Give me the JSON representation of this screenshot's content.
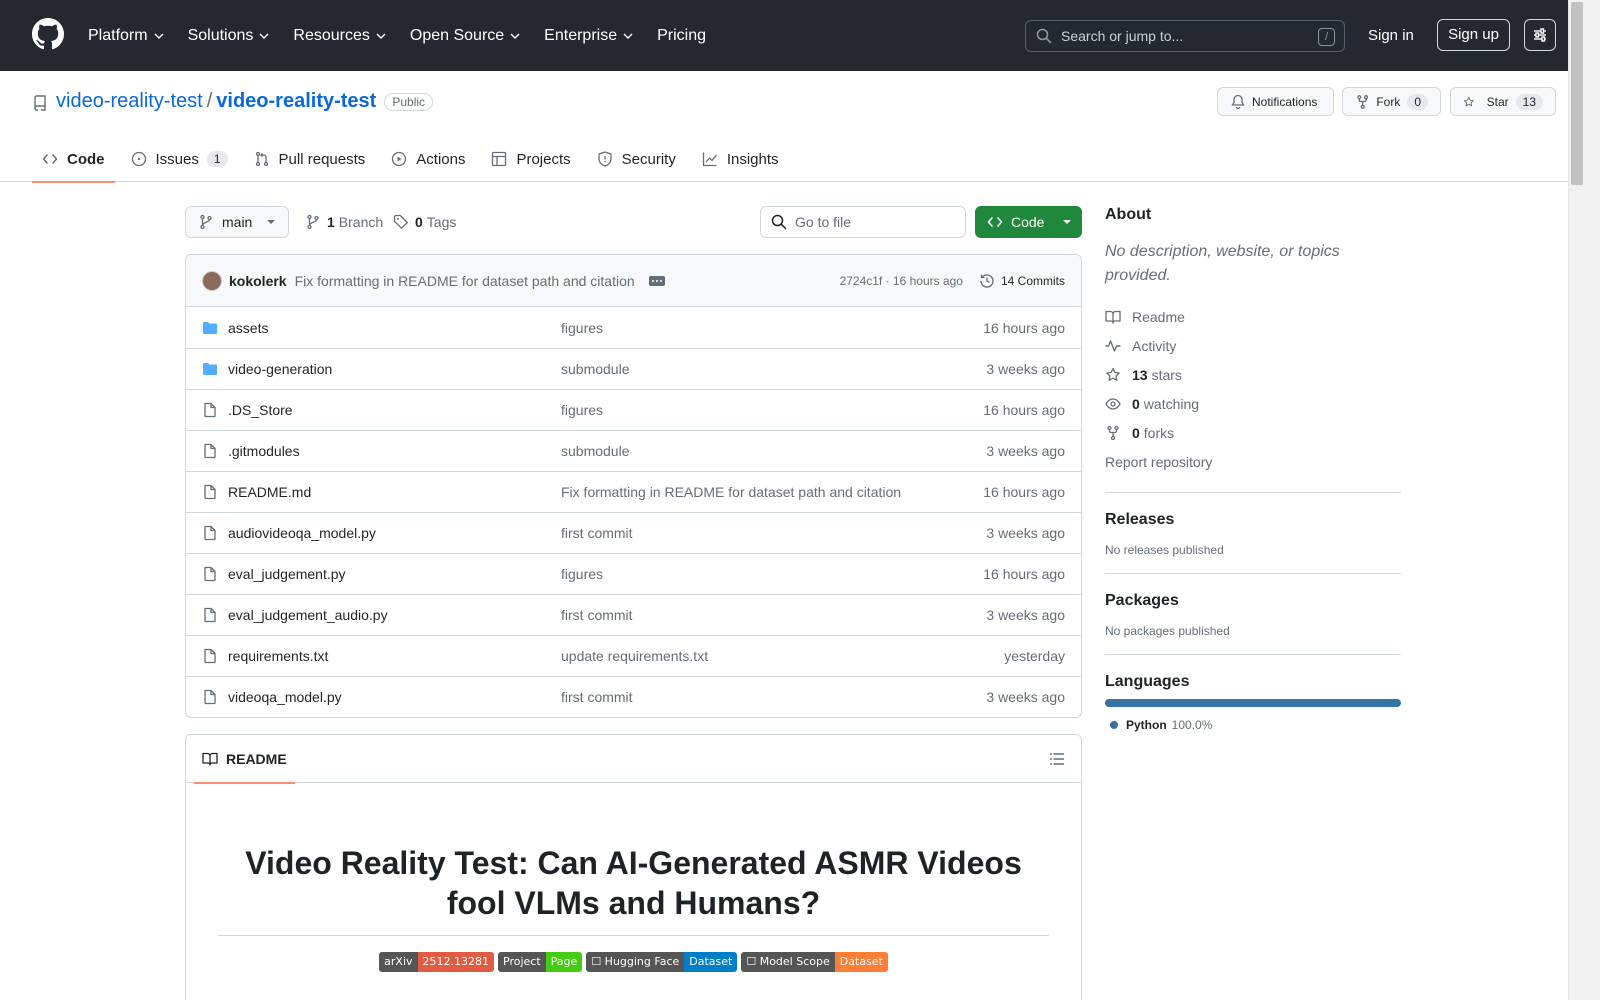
{
  "header": {
    "nav": [
      {
        "label": "Platform",
        "chevron": true
      },
      {
        "label": "Solutions",
        "chevron": true
      },
      {
        "label": "Resources",
        "chevron": true
      },
      {
        "label": "Open Source",
        "chevron": true
      },
      {
        "label": "Enterprise",
        "chevron": true
      },
      {
        "label": "Pricing",
        "chevron": false
      }
    ],
    "search_placeholder": "Search or jump to...",
    "search_shortcut": "/",
    "signin": "Sign in",
    "signup": "Sign up"
  },
  "repo": {
    "owner": "video-reality-test",
    "separator": "/",
    "name": "video-reality-test",
    "visibility": "Public",
    "notifications": "Notifications",
    "fork_label": "Fork",
    "fork_count": "0",
    "star_label": "Star",
    "star_count": "13"
  },
  "tabs": [
    {
      "label": "Code",
      "icon": "code-icon",
      "active": true
    },
    {
      "label": "Issues",
      "icon": "issue-icon",
      "count": "1"
    },
    {
      "label": "Pull requests",
      "icon": "pull-request-icon"
    },
    {
      "label": "Actions",
      "icon": "play-icon"
    },
    {
      "label": "Projects",
      "icon": "table-icon"
    },
    {
      "label": "Security",
      "icon": "shield-icon"
    },
    {
      "label": "Insights",
      "icon": "graph-icon"
    }
  ],
  "toolbar": {
    "branch": "main",
    "branch_count": "1",
    "branch_label": "Branch",
    "tag_count": "0",
    "tag_label": "Tags",
    "goto_placeholder": "Go to file",
    "code_label": "Code"
  },
  "commit": {
    "author": "kokolerk",
    "message": "Fix formatting in README for dataset path and citation",
    "meta": "2724c1f · 16 hours ago",
    "commits": "14 Commits"
  },
  "files": [
    {
      "name": "assets",
      "type": "dir",
      "message": "figures",
      "date": "16 hours ago"
    },
    {
      "name": "video-generation",
      "type": "dir",
      "message": "submodule",
      "date": "3 weeks ago"
    },
    {
      "name": ".DS_Store",
      "type": "file",
      "message": "figures",
      "date": "16 hours ago"
    },
    {
      "name": ".gitmodules",
      "type": "file",
      "message": "submodule",
      "date": "3 weeks ago"
    },
    {
      "name": "README.md",
      "type": "file",
      "message": "Fix formatting in README for dataset path and citation",
      "date": "16 hours ago"
    },
    {
      "name": "audiovideoqa_model.py",
      "type": "file",
      "message": "first commit",
      "date": "3 weeks ago"
    },
    {
      "name": "eval_judgement.py",
      "type": "file",
      "message": "figures",
      "date": "16 hours ago"
    },
    {
      "name": "eval_judgement_audio.py",
      "type": "file",
      "message": "first commit",
      "date": "3 weeks ago"
    },
    {
      "name": "requirements.txt",
      "type": "file",
      "message": "update requirements.txt",
      "date": "yesterday"
    },
    {
      "name": "videoqa_model.py",
      "type": "file",
      "message": "first commit",
      "date": "3 weeks ago"
    }
  ],
  "readme": {
    "tab_label": "README",
    "title": "Video Reality Test: Can AI-Generated ASMR Videos fool VLMs and Humans?",
    "badges": [
      {
        "left": "arXiv",
        "right": "2512.13281",
        "color": "#e05d44"
      },
      {
        "left": "Project",
        "right": "Page",
        "color": "#4c1"
      },
      {
        "left": "☐ Hugging Face",
        "right": "Dataset",
        "color": "#007ec6"
      },
      {
        "left": "☐ Model Scope",
        "right": "Dataset",
        "color": "#fe7d37"
      }
    ]
  },
  "about": {
    "title": "About",
    "description": "No description, website, or topics provided.",
    "readme": "Readme",
    "activity": "Activity",
    "stars_count": "13",
    "stars_label": "stars",
    "watching_count": "0",
    "watching_label": "watching",
    "forks_count": "0",
    "forks_label": "forks",
    "report": "Report repository"
  },
  "releases": {
    "title": "Releases",
    "text": "No releases published"
  },
  "packages": {
    "title": "Packages",
    "text": "No packages published"
  },
  "languages": {
    "title": "Languages",
    "items": [
      {
        "name": "Python",
        "percent": "100.0%",
        "color": "#3572A5"
      }
    ]
  }
}
